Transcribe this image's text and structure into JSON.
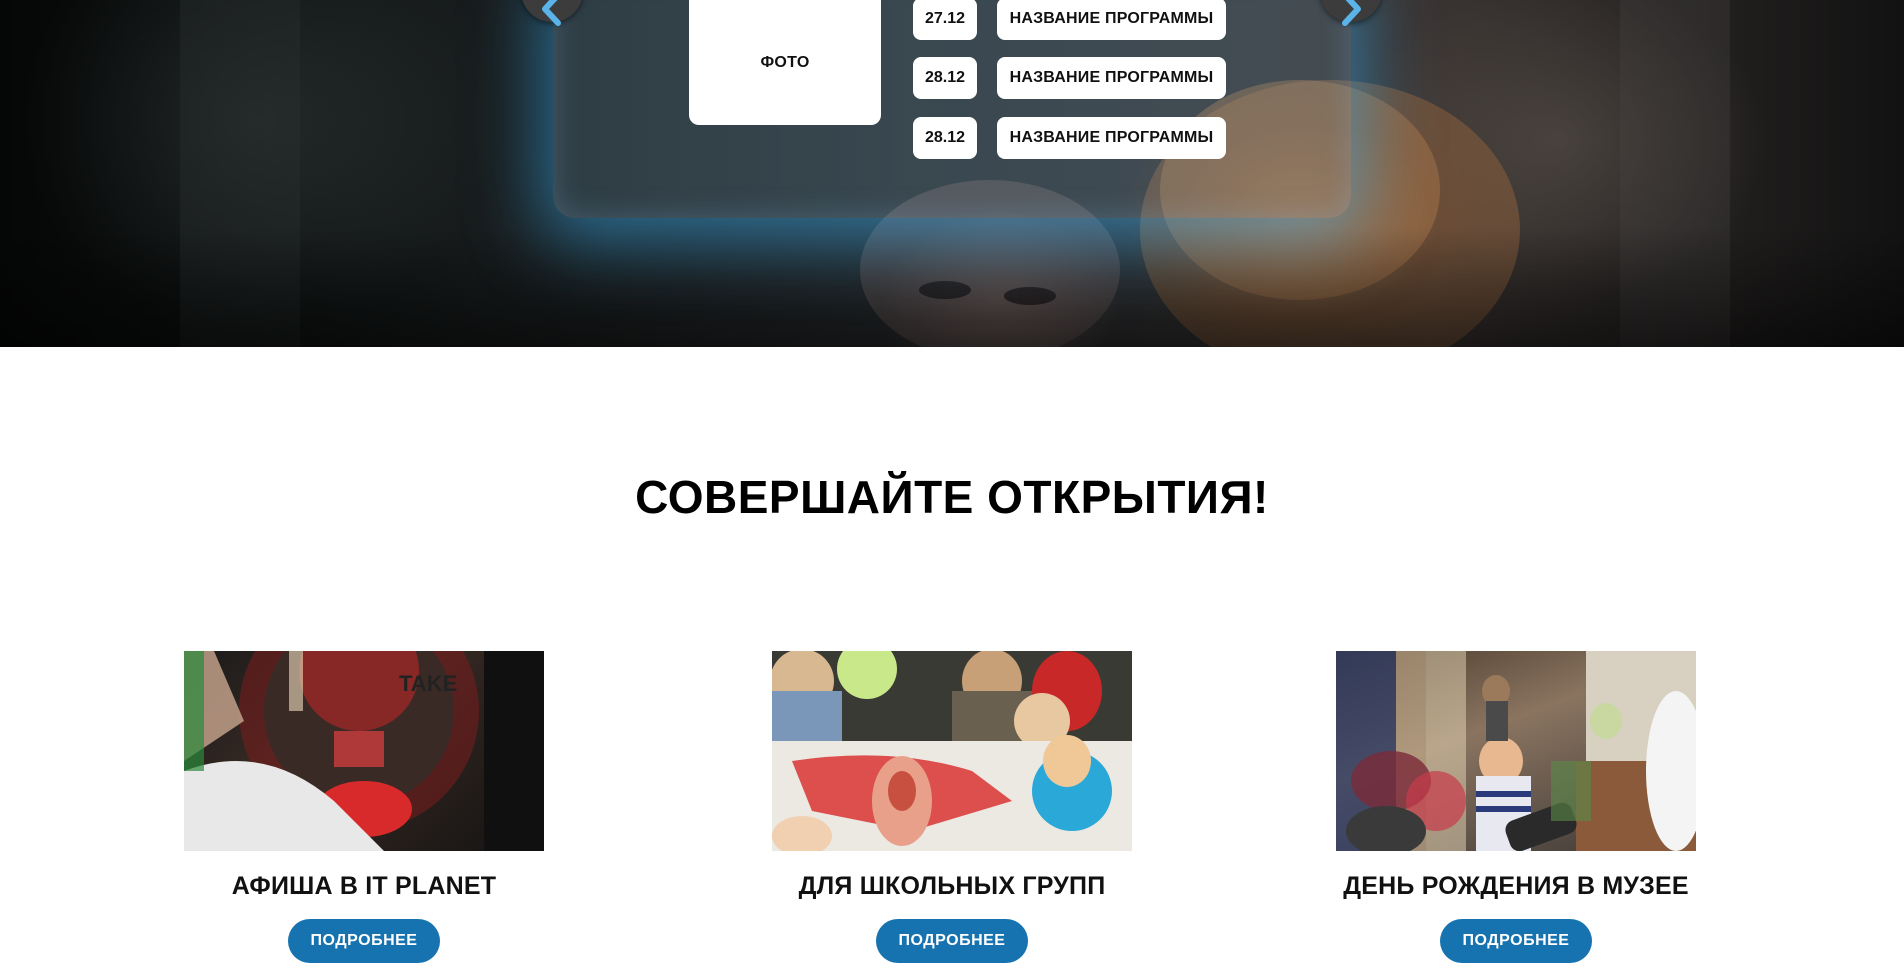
{
  "hero": {
    "photo_label": "ФОТО",
    "schedule": [
      {
        "date": "27.12",
        "program": "НАЗВАНИЕ ПРОГРАММЫ"
      },
      {
        "date": "28.12",
        "program": "НАЗВАНИЕ ПРОГРАММЫ"
      },
      {
        "date": "28.12",
        "program": "НАЗВАНИЕ ПРОГРАММЫ"
      }
    ],
    "prev_icon": "chevron-left-icon",
    "next_icon": "chevron-right-icon",
    "accent_color": "#5ab4ea"
  },
  "section": {
    "title": "СОВЕРШАЙТЕ ОТКРЫТИЯ!"
  },
  "cards": [
    {
      "title": "АФИША В IT PLANET",
      "button": "ПОДРОБНЕЕ"
    },
    {
      "title": "ДЛЯ ШКОЛЬНЫХ ГРУПП",
      "button": "ПОДРОБНЕЕ"
    },
    {
      "title": "ДЕНЬ РОЖДЕНИЯ В МУЗЕЕ",
      "button": "ПОДРОБНЕЕ"
    }
  ],
  "colors": {
    "button": "#1673b0",
    "glow": "#37aaeb"
  }
}
